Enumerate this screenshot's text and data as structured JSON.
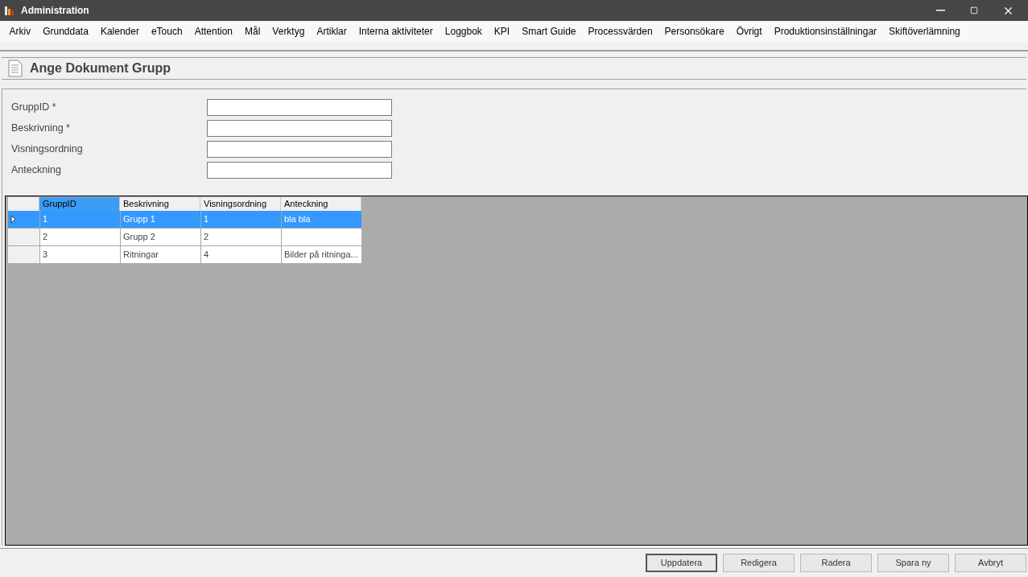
{
  "window": {
    "title": "Administration"
  },
  "menu": [
    "Arkiv",
    "Grunddata",
    "Kalender",
    "eTouch",
    "Attention",
    "Mål",
    "Verktyg",
    "Artiklar",
    "Interna aktiviteter",
    "Loggbok",
    "KPI",
    "Smart Guide",
    "Processvärden",
    "Personsökare",
    "Övrigt",
    "Produktionsinställningar",
    "Skiftöverlämning"
  ],
  "page_title": "Ange Dokument Grupp",
  "form": [
    {
      "label": "GruppID *"
    },
    {
      "label": "Beskrivning *"
    },
    {
      "label": "Visningsordning"
    },
    {
      "label": "Anteckning"
    }
  ],
  "table": {
    "columns": [
      {
        "label": "GruppID",
        "selected": true
      },
      {
        "label": "Beskrivning",
        "selected": false
      },
      {
        "label": "Visningsordning",
        "selected": false
      },
      {
        "label": "Anteckning",
        "selected": false
      }
    ],
    "rows": [
      {
        "selected": true,
        "cells": [
          "1",
          "Grupp 1",
          "1",
          "bla bla"
        ]
      },
      {
        "selected": false,
        "cells": [
          "2",
          "Grupp 2",
          "2",
          ""
        ]
      },
      {
        "selected": false,
        "cells": [
          "3",
          "Ritningar",
          "4",
          "Bilder på ritninga..."
        ]
      }
    ]
  },
  "buttons": [
    {
      "label": "Uppdatera",
      "selected": true
    },
    {
      "label": "Redigera",
      "selected": false
    },
    {
      "label": "Radera",
      "selected": false
    },
    {
      "label": "Spara ny",
      "selected": false
    },
    {
      "label": "Avbryt",
      "selected": false
    }
  ]
}
